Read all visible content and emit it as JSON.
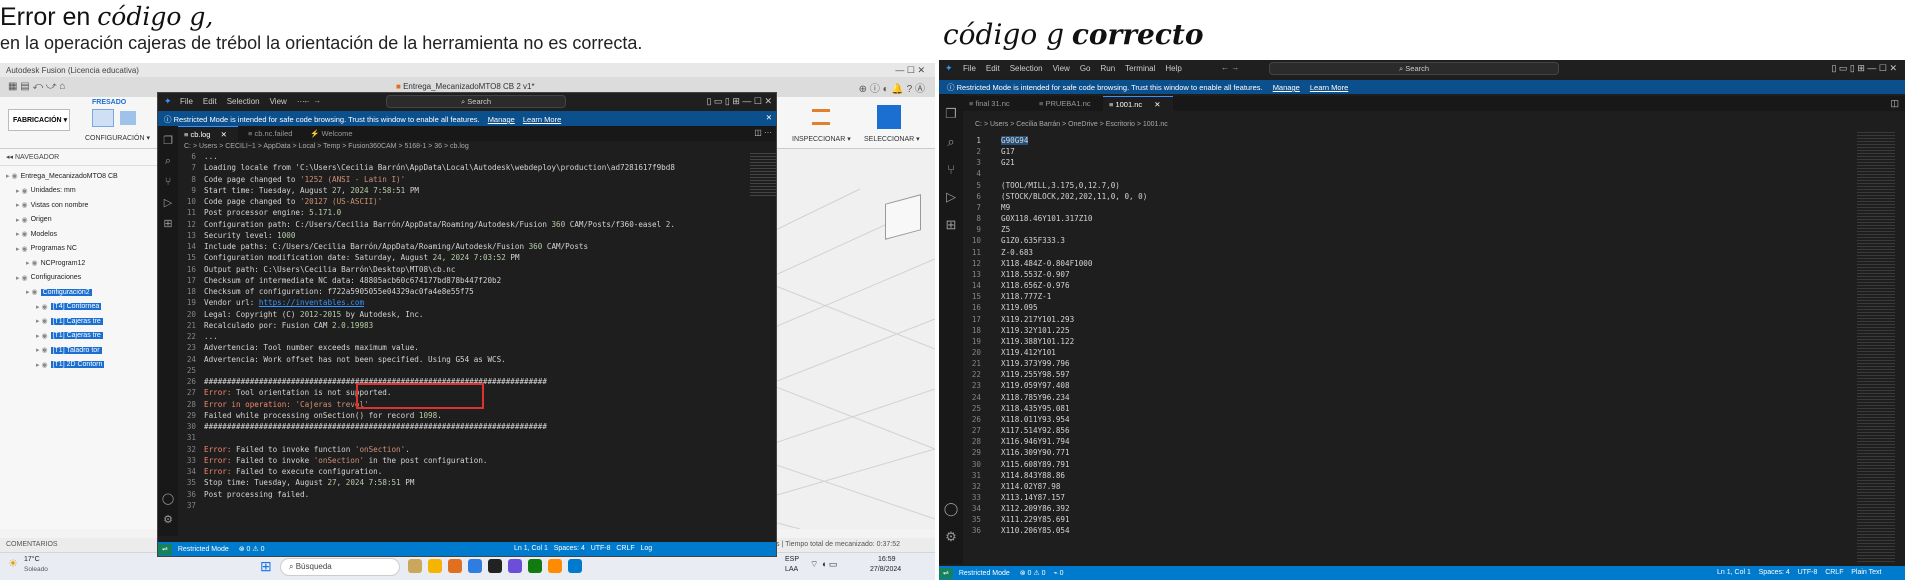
{
  "captions": {
    "left_title_prefix": "Error en ",
    "left_title_italic": "código g,",
    "left_subtitle": "en la operación cajeras de trébol la orientación de la herramienta no es correcta.",
    "right_title_italic": "código g",
    "right_title_bold": "correcto"
  },
  "fusion": {
    "window_title": "Autodesk Fusion (Licencia educativa)",
    "doc_tab": "Entrega_MecanizadoMTO8 CB 2 v1*",
    "ribbon_workspace": "FABRICACIÓN",
    "ribbon_tab": "FRESADO",
    "ribbon_config": "CONFIGURACIÓN",
    "ribbon_inspect": "INSPECCIONAR",
    "ribbon_select": "SELECCIONAR",
    "browser_header": "NAVEGADOR",
    "tree": [
      {
        "label": "Entrega_MecanizadoMTO8 CB",
        "sel": false,
        "indent": 0
      },
      {
        "label": "Unidades: mm",
        "sel": false,
        "indent": 1
      },
      {
        "label": "Vistas con nombre",
        "sel": false,
        "indent": 1
      },
      {
        "label": "Origen",
        "sel": false,
        "indent": 1
      },
      {
        "label": "Modelos",
        "sel": false,
        "indent": 1
      },
      {
        "label": "Programas NC",
        "sel": false,
        "indent": 1
      },
      {
        "label": "NCProgram12",
        "sel": false,
        "indent": 2
      },
      {
        "label": "Configuraciones",
        "sel": false,
        "indent": 1
      },
      {
        "label": "Configuración2",
        "sel": true,
        "indent": 2
      },
      {
        "label": "[T4] Contornea",
        "sel": true,
        "indent": 3
      },
      {
        "label": "[T1] Cajeras tre",
        "sel": true,
        "indent": 3
      },
      {
        "label": "[T1] Cajeras tre",
        "sel": true,
        "indent": 3
      },
      {
        "label": "[T1] Taladro tor",
        "sel": true,
        "indent": 3
      },
      {
        "label": "[T1] 2D Contorn",
        "sel": true,
        "indent": 3
      }
    ],
    "comments": "COMENTARIOS",
    "machining_time": "s | Tiempo total de mecanizado: 0:37:52",
    "weather_temp": "17°C",
    "weather_desc": "Soleado",
    "search_placeholder": "Búsqueda",
    "lang": "ESP",
    "lang2": "LAA",
    "time": "16:59",
    "date": "27/8/2024"
  },
  "vscode_left": {
    "menu": [
      "File",
      "Edit",
      "Selection",
      "View",
      "···"
    ],
    "search": "Search",
    "restricted_banner": "Restricted Mode is intended for safe code browsing. Trust this window to enable all features.",
    "manage": "Manage",
    "learn_more": "Learn More",
    "tabs": [
      "cb.log",
      "cb.nc.failed",
      "Welcome"
    ],
    "breadcrumb": "C: > Users > CECILI~1 > AppData > Local > Temp > Fusion360CAM > 5168-1 > 36 > cb.log",
    "status_mode": "Restricted Mode",
    "status_problems": "⊗ 0 ⚠ 0",
    "status_pos": "Ln 1, Col 1",
    "status_spaces": "Spaces: 4",
    "status_enc": "UTF-8",
    "status_eol": "CRLF",
    "status_lang": "Log",
    "lines": [
      {
        "n": "6",
        "t": "..."
      },
      {
        "n": "7",
        "t": "Loading locale from 'C:\\Users\\Cecilia Barrón\\AppData\\Local\\Autodesk\\webdeploy\\production\\ad7281617f9bd8"
      },
      {
        "n": "8",
        "t": "Code page changed to '1252 (ANSI - Latin I)'"
      },
      {
        "n": "9",
        "t": "Start time: Tuesday, August 27, 2024 7:58:51 PM"
      },
      {
        "n": "10",
        "t": "Code page changed to '20127 (US-ASCII)'"
      },
      {
        "n": "11",
        "t": "Post processor engine: 5.171.0"
      },
      {
        "n": "12",
        "t": "Configuration path: C:/Users/Cecilia Barrón/AppData/Roaming/Autodesk/Fusion 360 CAM/Posts/f360-easel 2."
      },
      {
        "n": "13",
        "t": "Security level: 1000"
      },
      {
        "n": "14",
        "t": "Include paths: C:/Users/Cecilia Barrón/AppData/Roaming/Autodesk/Fusion 360 CAM/Posts"
      },
      {
        "n": "15",
        "t": "Configuration modification date: Saturday, August 24, 2024 7:03:52 PM"
      },
      {
        "n": "16",
        "t": "Output path: C:\\Users\\Cecilia Barrón\\Desktop\\MT08\\cb.nc"
      },
      {
        "n": "17",
        "t": "Checksum of intermediate NC data: 48805acb60c674177bd878b447f20b2"
      },
      {
        "n": "18",
        "t": "Checksum of configuration: f722a5905055e04329ac0fa4e8e55f75"
      },
      {
        "n": "19",
        "t": "Vendor url: https://inventables.com"
      },
      {
        "n": "20",
        "t": "Legal: Copyright (C) 2012-2015 by Autodesk, Inc."
      },
      {
        "n": "21",
        "t": "Recalculado por: Fusion CAM 2.0.19983"
      },
      {
        "n": "22",
        "t": "..."
      },
      {
        "n": "23",
        "t": "Advertencia: Tool number exceeds maximum value."
      },
      {
        "n": "24",
        "t": "Advertencia: Work offset has not been specified. Using G54 as WCS."
      },
      {
        "n": "25",
        "t": ""
      },
      {
        "n": "26",
        "t": "###########################################################################"
      },
      {
        "n": "27",
        "t": "Error: Tool orientation is not supported."
      },
      {
        "n": "28",
        "t": "Error in operation: 'Cajeras trevol'"
      },
      {
        "n": "29",
        "t": "Failed while processing onSection() for record 1098."
      },
      {
        "n": "30",
        "t": "###########################################################################"
      },
      {
        "n": "31",
        "t": ""
      },
      {
        "n": "32",
        "t": "Error: Failed to invoke function 'onSection'."
      },
      {
        "n": "33",
        "t": "Error: Failed to invoke 'onSection' in the post configuration."
      },
      {
        "n": "34",
        "t": "Error: Failed to execute configuration."
      },
      {
        "n": "35",
        "t": "Stop time: Tuesday, August 27, 2024 7:58:51 PM"
      },
      {
        "n": "36",
        "t": "Post processing failed."
      },
      {
        "n": "37",
        "t": ""
      }
    ]
  },
  "vscode_right": {
    "menu": [
      "File",
      "Edit",
      "Selection",
      "View",
      "Go",
      "Run",
      "Terminal",
      "Help"
    ],
    "search": "Search",
    "restricted_banner": "Restricted Mode is intended for safe code browsing. Trust this window to enable all features.",
    "manage": "Manage",
    "learn_more": "Learn More",
    "tabs": [
      "final 31.nc",
      "PRUEBA1.nc",
      "1001.nc"
    ],
    "breadcrumb": "C: > Users > Cecilia Barrán > OneDrive > Escritorio > 1001.nc",
    "status_mode": "Restricted Mode",
    "status_problems": "⊗ 0 ⚠ 0",
    "status_wifi": "0",
    "status_pos": "Ln 1, Col 1",
    "status_spaces": "Spaces: 4",
    "status_enc": "UTF-8",
    "status_eol": "CRLF",
    "status_lang": "Plain Text",
    "lines": [
      {
        "n": "1",
        "t": "G90G94"
      },
      {
        "n": "2",
        "t": "G17"
      },
      {
        "n": "3",
        "t": "G21"
      },
      {
        "n": "4",
        "t": ""
      },
      {
        "n": "5",
        "t": "(TOOL/MILL,3.175,0,12.7,0)"
      },
      {
        "n": "6",
        "t": "(STOCK/BLOCK,202,202,11,0, 0, 0)"
      },
      {
        "n": "7",
        "t": "M9"
      },
      {
        "n": "8",
        "t": "G0X118.46Y101.317Z10"
      },
      {
        "n": "9",
        "t": "Z5"
      },
      {
        "n": "10",
        "t": "G1Z0.635F333.3"
      },
      {
        "n": "11",
        "t": "Z-0.683"
      },
      {
        "n": "12",
        "t": "X118.484Z-0.804F1000"
      },
      {
        "n": "13",
        "t": "X118.553Z-0.907"
      },
      {
        "n": "14",
        "t": "X118.656Z-0.976"
      },
      {
        "n": "15",
        "t": "X118.777Z-1"
      },
      {
        "n": "16",
        "t": "X119.095"
      },
      {
        "n": "17",
        "t": "X119.217Y101.293"
      },
      {
        "n": "18",
        "t": "X119.32Y101.225"
      },
      {
        "n": "19",
        "t": "X119.388Y101.122"
      },
      {
        "n": "20",
        "t": "X119.412Y101"
      },
      {
        "n": "21",
        "t": "X119.373Y99.796"
      },
      {
        "n": "22",
        "t": "X119.255Y98.597"
      },
      {
        "n": "23",
        "t": "X119.059Y97.408"
      },
      {
        "n": "24",
        "t": "X118.785Y96.234"
      },
      {
        "n": "25",
        "t": "X118.435Y95.081"
      },
      {
        "n": "26",
        "t": "X118.011Y93.954"
      },
      {
        "n": "27",
        "t": "X117.514Y92.856"
      },
      {
        "n": "28",
        "t": "X116.946Y91.794"
      },
      {
        "n": "29",
        "t": "X116.309Y90.771"
      },
      {
        "n": "30",
        "t": "X115.608Y89.791"
      },
      {
        "n": "31",
        "t": "X114.843Y88.86"
      },
      {
        "n": "32",
        "t": "X114.02Y87.98"
      },
      {
        "n": "33",
        "t": "X113.14Y87.157"
      },
      {
        "n": "34",
        "t": "X112.209Y86.392"
      },
      {
        "n": "35",
        "t": "X111.229Y85.691"
      },
      {
        "n": "36",
        "t": "X110.206Y85.054"
      }
    ]
  },
  "colors": {
    "vscode_bg": "#1e1e1e",
    "banner_blue": "#0b4f8c",
    "status_blue": "#007acc",
    "error_red": "#e03131",
    "fusion_select": "#1a6fd1"
  }
}
